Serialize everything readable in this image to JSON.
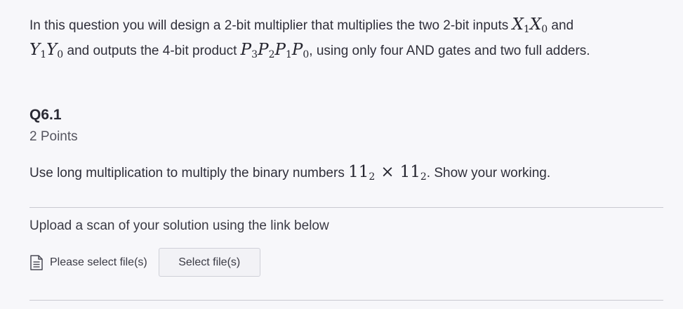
{
  "intro": {
    "line1_text": "In this question you will design a 2-bit multiplier that multiplies the two 2-bit inputs ",
    "x1": "X",
    "x1_sub": "1",
    "x0": "X",
    "x0_sub": "0",
    "line1_end": " and",
    "y1": "Y",
    "y1_sub": "1",
    "y0": "Y",
    "y0_sub": "0",
    "line2_text": " and outputs the 4-bit product ",
    "p3": "P",
    "p3_sub": "3",
    "p2": "P",
    "p2_sub": "2",
    "p1": "P",
    "p1_sub": "1",
    "p0": "P",
    "p0_sub": "0",
    "line2_end": ", using only four AND gates and two full adders."
  },
  "question": {
    "title": "Q6.1",
    "points": "2 Points",
    "prompt_start": "Use long multiplication to multiply the binary numbers ",
    "operand_a": "11",
    "operand_a_base": "2",
    "times": "×",
    "operand_b": "11",
    "operand_b_base": "2",
    "prompt_end": ". Show your working."
  },
  "upload": {
    "label": "Upload a scan of your solution using the link below",
    "file_status": "Please select file(s)",
    "button_label": "Select file(s)",
    "icon": "file-text-icon"
  }
}
